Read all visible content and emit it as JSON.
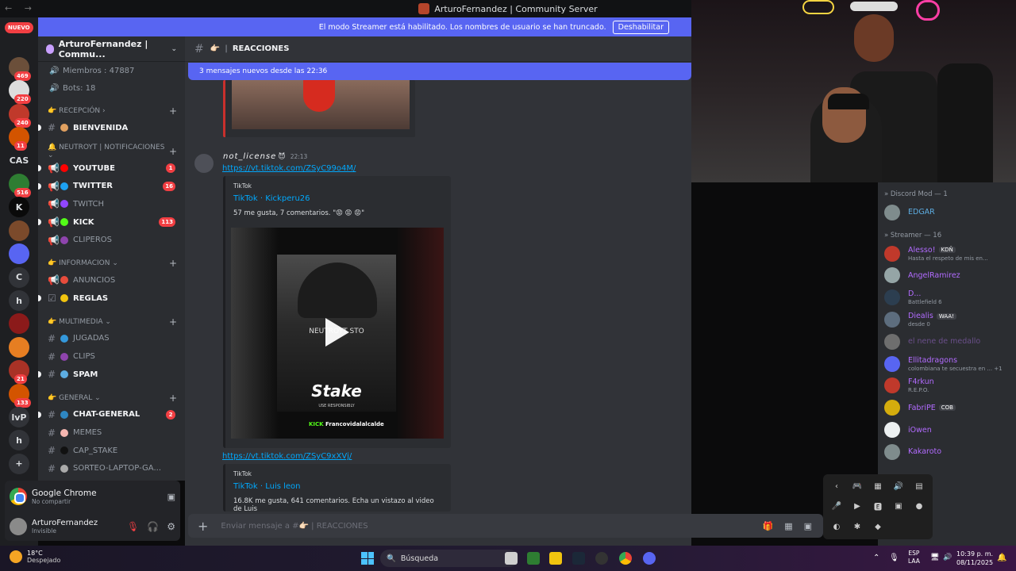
{
  "window": {
    "title": "ArturoFernandez | Community Server",
    "nav_arrows": "← →"
  },
  "streamer_banner": {
    "text": "El modo Streamer está habilitado. Los nombres de usuario se han truncado.",
    "button": "Deshabilitar"
  },
  "rail": {
    "nuevo": "NUEVO",
    "servers": [
      {
        "label": "",
        "badge": "469",
        "color": "#6b4f3a"
      },
      {
        "label": "",
        "badge": "220",
        "color": "#ddd"
      },
      {
        "label": "",
        "badge": "240",
        "color": "#c0392b"
      },
      {
        "label": "",
        "badge": "11",
        "color": "#d35400"
      },
      {
        "label": "CAS",
        "badge": "",
        "color": "#1e1f22"
      },
      {
        "label": "",
        "badge": "516",
        "color": "#2e7d32"
      },
      {
        "label": "K",
        "badge": "",
        "color": "#0a0a0a"
      },
      {
        "label": "",
        "badge": "",
        "color": "#7b4a2b"
      },
      {
        "label": "",
        "badge": "",
        "color": "#5865f2"
      },
      {
        "label": "C",
        "badge": "",
        "color": "#313338"
      },
      {
        "label": "h",
        "badge": "",
        "color": "#313338"
      },
      {
        "label": "",
        "badge": "",
        "color": "#8b1a1a"
      },
      {
        "label": "",
        "badge": "",
        "color": "#e67e22"
      },
      {
        "label": "",
        "badge": "21",
        "color": "#a93226"
      },
      {
        "label": "",
        "badge": "133",
        "color": "#d35400"
      },
      {
        "label": "lvP",
        "badge": "",
        "color": "#313338"
      },
      {
        "label": "h",
        "badge": "",
        "color": "#313338"
      },
      {
        "label": "+",
        "badge": "",
        "color": "#313338"
      }
    ]
  },
  "sidebar": {
    "server_name": "ArturoFernandez | Commu...",
    "stats": [
      {
        "icon": "🔊",
        "label": "Miembros : 47887"
      },
      {
        "icon": "🔊",
        "label": "Bots: 18"
      }
    ],
    "categories": [
      {
        "label": "👉 RECEPCIÓN ›",
        "channels": [
          {
            "name": "BIENVENIDA",
            "icon": "#",
            "emoji_color": "#e0a060",
            "unread": true,
            "badge": ""
          }
        ]
      },
      {
        "label": "🔔 NEUTROYT | NOTIFICACIONES ⌄",
        "channels": [
          {
            "name": "YOUTUBE",
            "icon": "📢",
            "emoji_color": "#ff0000",
            "unread": true,
            "badge": "1"
          },
          {
            "name": "TWITTER",
            "icon": "📢",
            "emoji_color": "#1da1f2",
            "unread": true,
            "badge": "16"
          },
          {
            "name": "TWITCH",
            "icon": "📢",
            "emoji_color": "#9146ff",
            "unread": false,
            "badge": ""
          },
          {
            "name": "KICK",
            "icon": "📢",
            "emoji_color": "#53fc18",
            "unread": true,
            "badge": "113"
          },
          {
            "name": "CLIPEROS",
            "icon": "📢",
            "emoji_color": "#8e44ad",
            "unread": false,
            "badge": ""
          }
        ]
      },
      {
        "label": "👉 INFORMACION ⌄",
        "channels": [
          {
            "name": "ANUNCIOS",
            "icon": "📢",
            "emoji_color": "#e74c3c",
            "unread": false,
            "badge": ""
          },
          {
            "name": "REGLAS",
            "icon": "☑",
            "emoji_color": "#f1c40f",
            "unread": true,
            "badge": ""
          }
        ]
      },
      {
        "label": "👉 MULTIMEDIA ⌄",
        "channels": [
          {
            "name": "JUGADAS",
            "icon": "#",
            "emoji_color": "#3498db",
            "unread": false,
            "badge": ""
          },
          {
            "name": "CLIPS",
            "icon": "#",
            "emoji_color": "#8e44ad",
            "unread": false,
            "badge": ""
          },
          {
            "name": "SPAM",
            "icon": "#",
            "emoji_color": "#5dade2",
            "unread": true,
            "badge": ""
          }
        ]
      },
      {
        "label": "👉 GENERAL ⌄",
        "channels": [
          {
            "name": "CHAT-GENERAL",
            "icon": "#",
            "emoji_color": "#2e86c1",
            "unread": true,
            "badge": "2"
          },
          {
            "name": "MEMES",
            "icon": "#",
            "emoji_color": "#f5b7b1",
            "unread": false,
            "badge": ""
          },
          {
            "name": "CAP_STAKE",
            "icon": "#",
            "emoji_color": "#111111",
            "unread": false,
            "badge": ""
          },
          {
            "name": "SORTEO-LAPTOP-GA...",
            "icon": "#",
            "emoji_color": "#aaaaaa",
            "unread": false,
            "badge": ""
          }
        ]
      }
    ]
  },
  "voice_panel": {
    "app": "Google Chrome",
    "status": "No compartir"
  },
  "user_panel": {
    "name": "ArturoFernandez",
    "status": "Invisible"
  },
  "chat": {
    "channel": "REACCIONES",
    "channel_emoji": "👉🏻",
    "new_messages": "3 mensajes nuevos desde las 22:36",
    "message": {
      "author": "not_license",
      "badge": "😈",
      "time": "22:13"
    },
    "embeds": [
      {
        "link": "https://vt.tiktok.com/ZSyC99o4M/",
        "provider": "TikTok",
        "title": "TikTok · Kickperu26",
        "desc": "57 me gusta, 7 comentarios. \"😡 😡 😡\"",
        "video_caption": "NEUTROYT STO",
        "video_logo": "Stake",
        "video_sub": "USE RESPONSIBLY",
        "video_kick": "Francovidalalcalde"
      },
      {
        "link": "https://vt.tiktok.com/ZSyC9xXVj/",
        "provider": "TikTok",
        "title": "TikTok · Luis leon",
        "desc": "16.8K me gusta, 641 comentarios. Echa un vistazo al video de Luis"
      }
    ],
    "composer_placeholder": "Enviar mensaje a #👉🏻 | REACCIONES"
  },
  "members": {
    "groups": [
      {
        "label": "» Discord Mod — 1",
        "members": [
          {
            "name": "EDGAR",
            "status": "",
            "tag": "",
            "color": "#5dade2",
            "avatar": "#7f8c8d"
          }
        ]
      },
      {
        "label": "» Streamer — 16",
        "members": [
          {
            "name": "Alesso!",
            "status": "Hasta el respeto de mis en...",
            "tag": "KDÑ",
            "color": "#b26bff",
            "avatar": "#c0392b"
          },
          {
            "name": "AngelRamirez",
            "status": "",
            "tag": "",
            "color": "#b26bff",
            "avatar": "#95a5a6"
          },
          {
            "name": "D...",
            "status": "Battlefield 6",
            "tag": "",
            "color": "#b26bff",
            "avatar": "#2c3e50"
          },
          {
            "name": "Diealis",
            "status": "desde 0",
            "tag": "WAA!",
            "color": "#b26bff",
            "avatar": "#5d6d7e"
          },
          {
            "name": "el nene de medallo",
            "status": "",
            "tag": "",
            "color": "#6a4f8a",
            "avatar": "#6e6e6e"
          },
          {
            "name": "Ellitadragons",
            "status": "colombiana te secuestra en ... +1",
            "tag": "",
            "color": "#b26bff",
            "avatar": "#5865f2"
          },
          {
            "name": "F4rkun",
            "status": "R.E.P.O.",
            "tag": "",
            "color": "#b26bff",
            "avatar": "#c0392b"
          },
          {
            "name": "FabriPE",
            "status": "",
            "tag": "COB",
            "color": "#b26bff",
            "avatar": "#d4ac0d"
          },
          {
            "name": "iOwen",
            "status": "",
            "tag": "",
            "color": "#b26bff",
            "avatar": "#ecf0f1"
          },
          {
            "name": "Kakaroto",
            "status": "",
            "tag": "",
            "color": "#b26bff",
            "avatar": "#7f8c8d"
          }
        ]
      }
    ]
  },
  "tray_icons": [
    "‹",
    "🎮",
    "▦",
    "🔊",
    "▤",
    "🎤",
    "▶",
    "🅴",
    "▣",
    "●",
    "◐",
    "✱",
    "◆"
  ],
  "taskbar": {
    "weather_temp": "18°C",
    "weather_desc": "Despejado",
    "search": "Búsqueda",
    "lang1": "ESP",
    "lang2": "LAA",
    "time": "10:39 p. m.",
    "date": "08/11/2025"
  }
}
